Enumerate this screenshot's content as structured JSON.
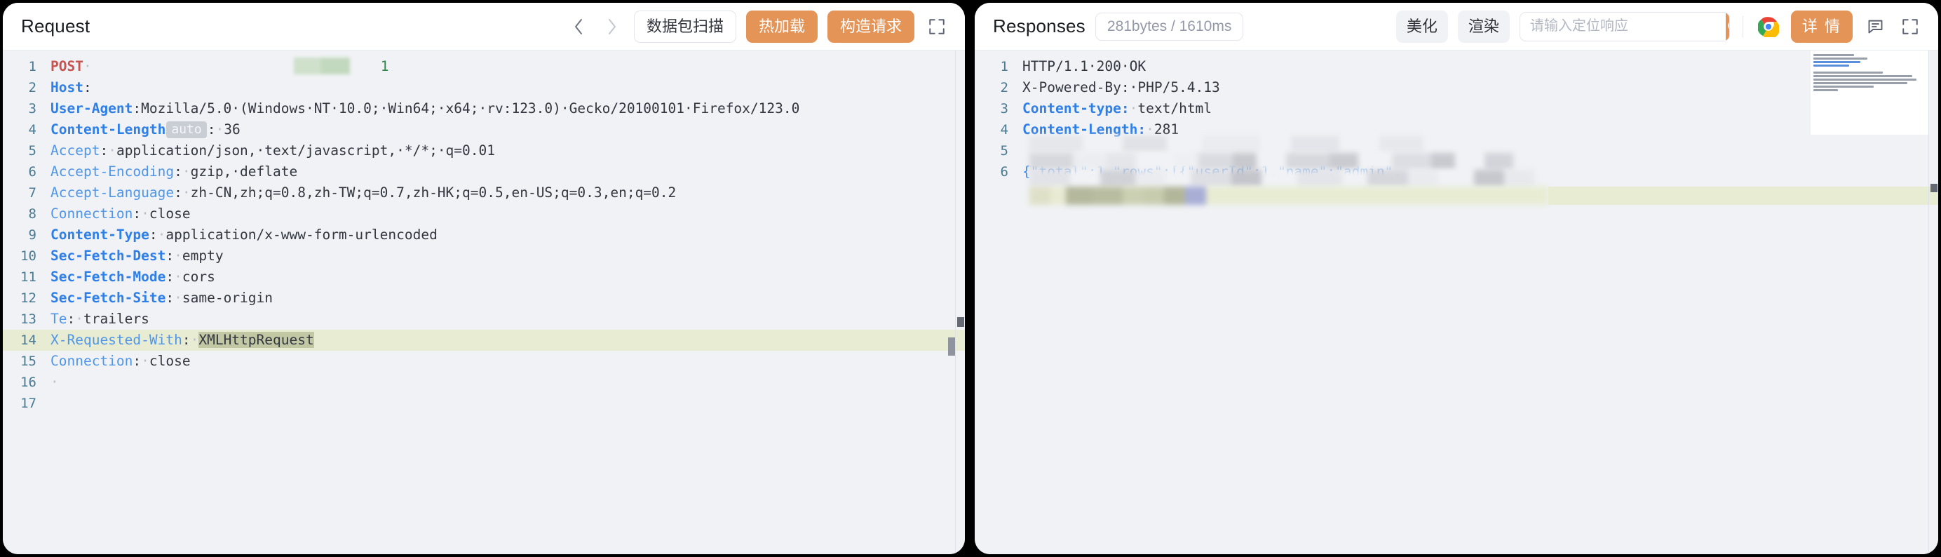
{
  "request_panel": {
    "title": "Request",
    "toolbar": {
      "prev_label": "‹",
      "next_label": "›",
      "scan_label": "数据包扫描",
      "hotreload_label": "热加载",
      "build_label": "构造请求",
      "expand_label": "⛶"
    },
    "accent_color": "#e59457",
    "lines": [
      {
        "n": "1",
        "kind": "redacted_post"
      },
      {
        "n": "2",
        "kind": "redacted_host"
      },
      {
        "n": "3",
        "kind": "wrap",
        "header": "User-Agent",
        "value": "Mozilla/5.0·(Windows·NT·10.0;·Win64;·x64;·rv:123.0)·Gecko/20100101·Firefox/123.0"
      },
      {
        "n": "4",
        "kind": "auto",
        "header": "Content-Length",
        "badge": "auto",
        "value": "36"
      },
      {
        "n": "5",
        "kind": "kv",
        "header": "Accept",
        "value": "application/json,·text/javascript,·*/*;·q=0.01"
      },
      {
        "n": "6",
        "kind": "kv",
        "header": "Accept-Encoding",
        "value": "gzip,·deflate"
      },
      {
        "n": "7",
        "kind": "kv",
        "header": "Accept-Language",
        "value": "zh-CN,zh;q=0.8,zh-TW;q=0.7,zh-HK;q=0.5,en-US;q=0.3,en;q=0.2"
      },
      {
        "n": "8",
        "kind": "kv",
        "header": "Connection",
        "value": "close"
      },
      {
        "n": "9",
        "kind": "kv",
        "header": "Content-Type",
        "value": "application/x-www-form-urlencoded"
      },
      {
        "n": "10",
        "kind": "kv",
        "header": "Sec-Fetch-Dest",
        "value": "empty"
      },
      {
        "n": "11",
        "kind": "kv",
        "header": "Sec-Fetch-Mode",
        "value": "cors"
      },
      {
        "n": "12",
        "kind": "kv",
        "header": "Sec-Fetch-Site",
        "value": "same-origin"
      },
      {
        "n": "13",
        "kind": "kv",
        "header": "Te",
        "value": "trailers"
      },
      {
        "n": "14",
        "kind": "selected",
        "header": "X-Requested-With",
        "value": "XMLHttpRequest"
      },
      {
        "n": "15",
        "kind": "kv",
        "header": "Connection",
        "value": "close"
      },
      {
        "n": "16",
        "kind": "space"
      },
      {
        "n": "17",
        "kind": "redacted_body"
      }
    ]
  },
  "response_panel": {
    "title": "Responses",
    "meta": "281bytes / 1610ms",
    "toolbar": {
      "beautify_label": "美化",
      "render_label": "渲染",
      "detail_label": "详 情",
      "expand_label": "⛶"
    },
    "search": {
      "placeholder": "请输入定位响应",
      "value": "",
      "button_icon": "search-icon"
    },
    "accent_color": "#e59457",
    "lines": [
      {
        "n": "1",
        "kind": "plain",
        "value": "HTTP/1.1·200·OK"
      },
      {
        "n": "2",
        "kind": "plain",
        "value": "X-Powered-By:·PHP/5.4.13"
      },
      {
        "n": "3",
        "kind": "kv",
        "header": "Content-type:",
        "value": "text/html"
      },
      {
        "n": "4",
        "kind": "kv",
        "header": "Content-Length:",
        "value": "281"
      },
      {
        "n": "5",
        "kind": "empty"
      },
      {
        "n": "6",
        "kind": "json",
        "value": "{\"total\":1,\"rows\":[{\"userId\":1,\"name\":\"admin\","
      }
    ]
  }
}
